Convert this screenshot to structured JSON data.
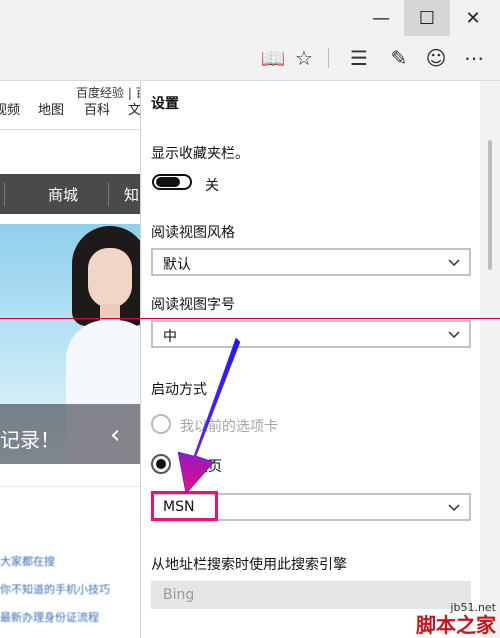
{
  "window": {
    "minimize_glyph": "—",
    "maximize_glyph": "☐",
    "close_glyph": "✕"
  },
  "toolbar": {
    "icons": [
      "reading-view-icon",
      "favorite-star-icon",
      "hub-icon",
      "web-note-icon",
      "feedback-smile-icon",
      "more-icon"
    ],
    "reading_view_glyph": "📖",
    "star_glyph": "☆",
    "hub_glyph": "☰",
    "note_glyph": "✎",
    "smile_glyph": "☺",
    "more_glyph": "⋯"
  },
  "webpage": {
    "top_link": "百度经验 | 百",
    "nav": [
      "视频",
      "地图",
      "百科",
      "文"
    ],
    "category_bar": [
      "商城",
      "知"
    ],
    "caption": "记录！",
    "arrow": "‹",
    "links": [
      "大家都在搜",
      "你不知道的手机小技巧",
      "最新办理身份证流程"
    ]
  },
  "settings": {
    "title": "设置",
    "favorites_bar_label": "显示收藏夹栏。",
    "favorites_bar_state": "关",
    "reading_style_label": "阅读视图风格",
    "reading_style_value": "默认",
    "reading_font_label": "阅读视图字号",
    "reading_font_value": "中",
    "startup_label": "启动方式",
    "startup_options": [
      {
        "label": "我以前的选项卡",
        "checked": false,
        "disabled": true
      },
      {
        "label": "特定页",
        "checked": true,
        "disabled": false
      }
    ],
    "startup_page_value": "MSN",
    "search_engine_label": "从地址栏搜索时使用此搜索引擎",
    "search_engine_value": "Bing"
  },
  "watermark": {
    "site": "jb51.net",
    "name": "脚本之家"
  },
  "colors": {
    "annotation_arrow": "#1a1aff",
    "highlight_box": "#e8127a",
    "red_line": "#d4003a"
  }
}
